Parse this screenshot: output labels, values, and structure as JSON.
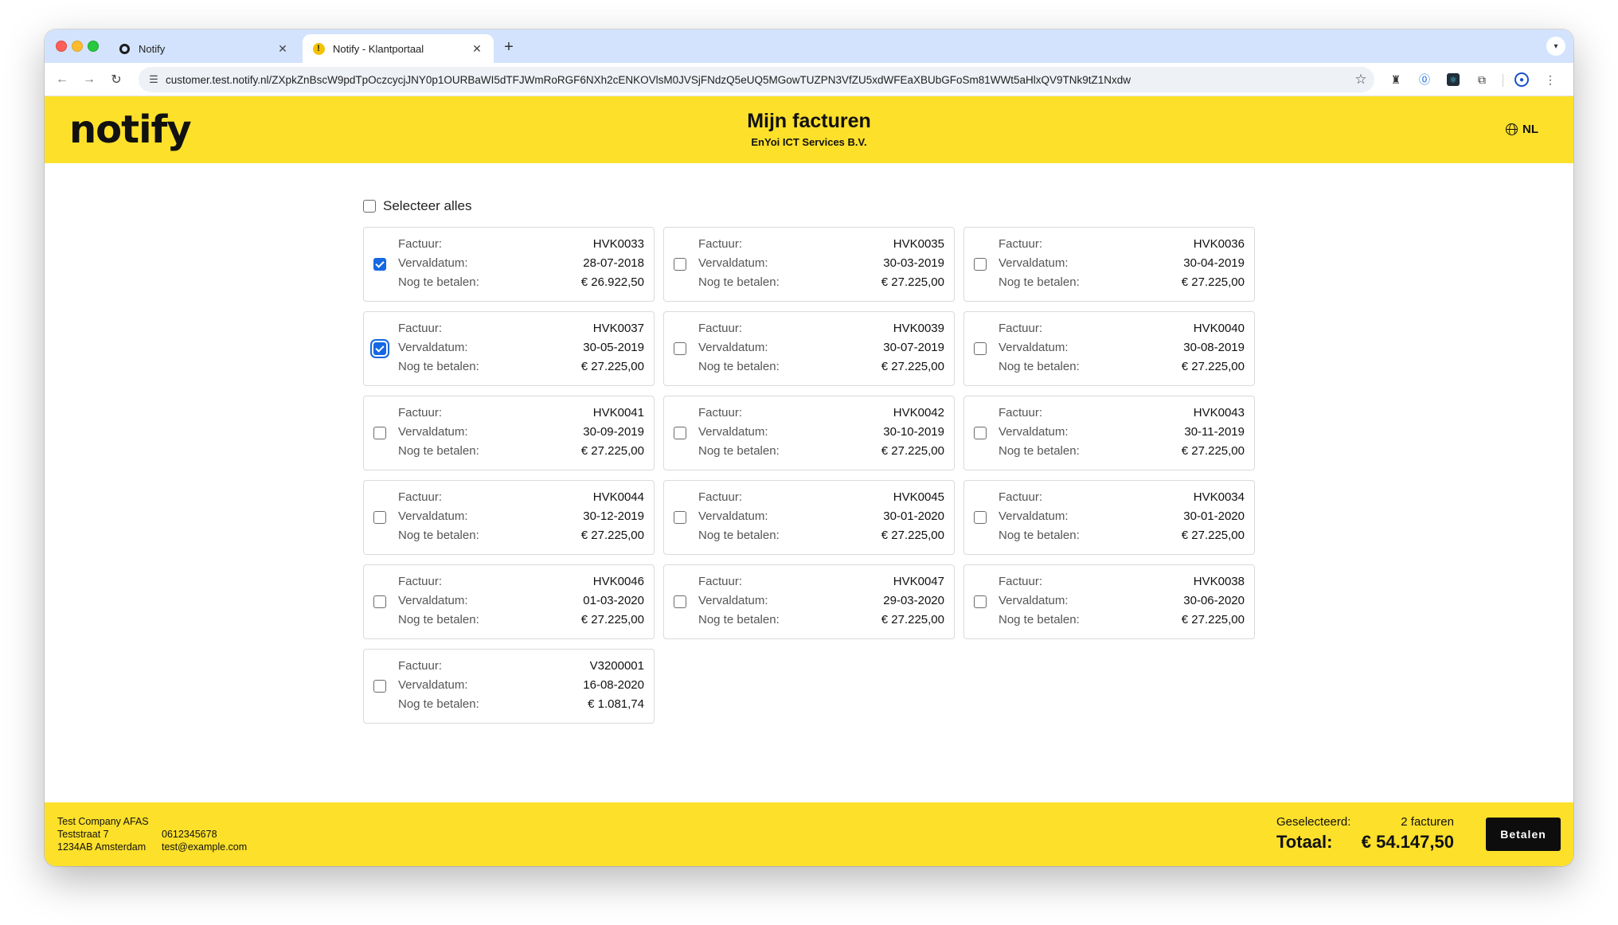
{
  "browser": {
    "tabs": [
      {
        "title": "Notify",
        "icon": "notify-ring-icon"
      },
      {
        "title": "Notify - Klantportaal",
        "icon": "warning-icon"
      }
    ],
    "url": "customer.test.notify.nl/ZXpkZnBscW9pdTpOczcycjJNY0p1OURBaWI5dTFJWmRoRGF6NXh2cENKOVlsM0JVSjFNdzQ5eUQ5MGowTUZPN3VfZU5xdWFEaXBUbGFoSm81WWt5aHlxQV9TNk9tZ1Nxdw"
  },
  "header": {
    "logo": "notify",
    "title": "Mijn facturen",
    "subtitle": "EnYoi ICT Services B.V.",
    "language": "NL"
  },
  "select_all": {
    "label": "Selecteer alles",
    "checked": false
  },
  "labels": {
    "invoice": "Factuur:",
    "due_date": "Vervaldatum:",
    "outstanding": "Nog te betalen:"
  },
  "invoices": [
    {
      "number": "HVK0033",
      "due": "28-07-2018",
      "amount": "€ 26.922,50",
      "checked": true
    },
    {
      "number": "HVK0035",
      "due": "30-03-2019",
      "amount": "€ 27.225,00",
      "checked": false
    },
    {
      "number": "HVK0036",
      "due": "30-04-2019",
      "amount": "€ 27.225,00",
      "checked": false
    },
    {
      "number": "HVK0037",
      "due": "30-05-2019",
      "amount": "€ 27.225,00",
      "checked": true,
      "focused": true
    },
    {
      "number": "HVK0039",
      "due": "30-07-2019",
      "amount": "€ 27.225,00",
      "checked": false
    },
    {
      "number": "HVK0040",
      "due": "30-08-2019",
      "amount": "€ 27.225,00",
      "checked": false
    },
    {
      "number": "HVK0041",
      "due": "30-09-2019",
      "amount": "€ 27.225,00",
      "checked": false
    },
    {
      "number": "HVK0042",
      "due": "30-10-2019",
      "amount": "€ 27.225,00",
      "checked": false
    },
    {
      "number": "HVK0043",
      "due": "30-11-2019",
      "amount": "€ 27.225,00",
      "checked": false
    },
    {
      "number": "HVK0044",
      "due": "30-12-2019",
      "amount": "€ 27.225,00",
      "checked": false
    },
    {
      "number": "HVK0045",
      "due": "30-01-2020",
      "amount": "€ 27.225,00",
      "checked": false
    },
    {
      "number": "HVK0034",
      "due": "30-01-2020",
      "amount": "€ 27.225,00",
      "checked": false
    },
    {
      "number": "HVK0046",
      "due": "01-03-2020",
      "amount": "€ 27.225,00",
      "checked": false
    },
    {
      "number": "HVK0047",
      "due": "29-03-2020",
      "amount": "€ 27.225,00",
      "checked": false
    },
    {
      "number": "HVK0038",
      "due": "30-06-2020",
      "amount": "€ 27.225,00",
      "checked": false
    },
    {
      "number": "V3200001",
      "due": "16-08-2020",
      "amount": "€ 1.081,74",
      "checked": false
    }
  ],
  "footer": {
    "company": "Test Company AFAS",
    "street": "Teststraat 7",
    "city": "1234AB Amsterdam",
    "phone": "0612345678",
    "email": "test@example.com",
    "selected_label": "Geselecteerd:",
    "selected_count": "2 facturen",
    "total_label": "Totaal:",
    "total_value": "€ 54.147,50",
    "pay_button": "Betalen"
  },
  "colors": {
    "brand_yellow": "#fde02a",
    "checkbox_blue": "#1668e3"
  }
}
